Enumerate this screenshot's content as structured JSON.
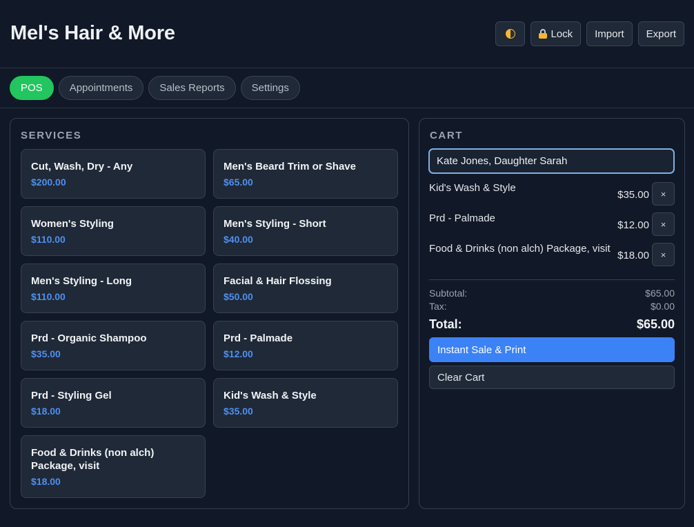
{
  "app": {
    "title": "Mel's Hair & More"
  },
  "header": {
    "theme_icon": "half-moon-theme-icon",
    "lock_label": "Lock",
    "lock_icon": "lock-icon",
    "import_label": "Import",
    "export_label": "Export"
  },
  "tabs": [
    {
      "label": "POS",
      "active": true
    },
    {
      "label": "Appointments",
      "active": false
    },
    {
      "label": "Sales Reports",
      "active": false
    },
    {
      "label": "Settings",
      "active": false
    }
  ],
  "services": {
    "title": "SERVICES",
    "items": [
      {
        "name": "Cut, Wash, Dry - Any",
        "price": "$200.00"
      },
      {
        "name": "Men's Beard Trim or Shave",
        "price": "$65.00"
      },
      {
        "name": "Women's Styling",
        "price": "$110.00"
      },
      {
        "name": "Men's Styling - Short",
        "price": "$40.00"
      },
      {
        "name": "Men's Styling - Long",
        "price": "$110.00"
      },
      {
        "name": "Facial & Hair Flossing",
        "price": "$50.00"
      },
      {
        "name": "Prd - Organic Shampoo",
        "price": "$35.00"
      },
      {
        "name": "Prd - Palmade",
        "price": "$12.00"
      },
      {
        "name": "Prd - Styling Gel",
        "price": "$18.00"
      },
      {
        "name": "Kid's Wash & Style",
        "price": "$35.00"
      },
      {
        "name": "Food & Drinks (non alch) Package, visit",
        "price": "$18.00"
      }
    ]
  },
  "cart": {
    "title": "CART",
    "customer_value": "Kate Jones, Daughter Sarah",
    "items": [
      {
        "name": "Kid's Wash & Style",
        "price": "$35.00"
      },
      {
        "name": "Prd - Palmade",
        "price": "$12.00"
      },
      {
        "name": "Food & Drinks (non alch) Package, visit",
        "price": "$18.00"
      }
    ],
    "remove_label": "×",
    "subtotal_label": "Subtotal:",
    "subtotal_value": "$65.00",
    "tax_label": "Tax:",
    "tax_value": "$0.00",
    "total_label": "Total:",
    "total_value": "$65.00",
    "sale_button": "Instant Sale & Print",
    "clear_button": "Clear Cart"
  },
  "colors": {
    "background": "#111827",
    "card": "#1f2937",
    "accent_green": "#22c55e",
    "accent_blue": "#3b82f6",
    "price_blue": "#4f8ff0"
  }
}
